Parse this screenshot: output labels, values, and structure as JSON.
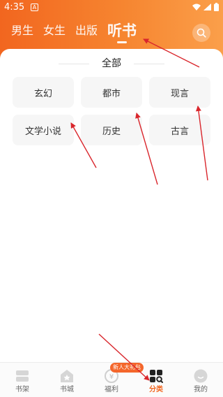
{
  "status_bar": {
    "time": "4:35",
    "notification_glyph": "A",
    "icons": [
      "wifi-icon",
      "signal-icon",
      "battery-icon"
    ]
  },
  "top_tabs": [
    {
      "label": "男生",
      "active": false
    },
    {
      "label": "女生",
      "active": false
    },
    {
      "label": "出版",
      "active": false
    },
    {
      "label": "听书",
      "active": true
    }
  ],
  "panel": {
    "title": "全部",
    "categories": [
      "玄幻",
      "都市",
      "现言",
      "文学小说",
      "历史",
      "古言"
    ]
  },
  "bottom_nav": {
    "items": [
      {
        "label": "书架",
        "icon": "bookshelf-icon",
        "active": false
      },
      {
        "label": "书城",
        "icon": "store-icon",
        "active": false
      },
      {
        "label": "福利",
        "icon": "welfare-coin-icon",
        "active": false
      },
      {
        "label": "分类",
        "icon": "category-icon",
        "active": true
      },
      {
        "label": "我的",
        "icon": "profile-icon",
        "active": false
      }
    ],
    "promo_badge": "新人大礼包"
  },
  "colors": {
    "header_start": "#f2661f",
    "header_end": "#fb9f4a",
    "accent": "#f2661f",
    "annotation_arrow": "#d9262c"
  }
}
